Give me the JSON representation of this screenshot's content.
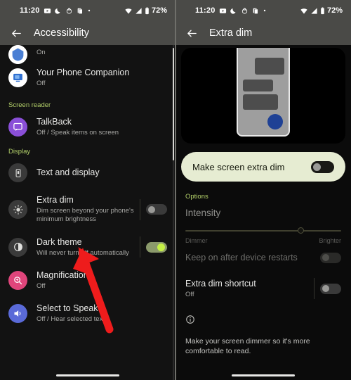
{
  "statusbar": {
    "time": "11:20",
    "battery_percent": "72%",
    "icons": [
      "youtube-icon",
      "moon-icon",
      "do-not-disturb-icon",
      "copy-icon",
      "dot-icon",
      "wifi-icon",
      "signal-icon",
      "battery-icon"
    ]
  },
  "left_panel": {
    "title": "Accessibility",
    "back_icon": "back-arrow-icon",
    "partial_item": {
      "subtitle": "On",
      "icon": "app-icon"
    },
    "items_top": [
      {
        "title": "Your Phone Companion",
        "subtitle": "Off",
        "icon": "phone-companion-icon"
      }
    ],
    "sections": [
      {
        "label": "Screen reader",
        "items": [
          {
            "title": "TalkBack",
            "subtitle": "Off / Speak items on screen",
            "icon": "talkback-icon"
          }
        ]
      },
      {
        "label": "Display",
        "items": [
          {
            "title": "Text and display",
            "subtitle": "",
            "icon": "text-display-icon",
            "toggle": null
          },
          {
            "title": "Extra dim",
            "subtitle": "Dim screen beyond your phone's minimum brightness",
            "icon": "extra-dim-icon",
            "toggle": "off"
          },
          {
            "title": "Dark theme",
            "subtitle": "Will never turn off automatically",
            "icon": "dark-theme-icon",
            "toggle": "on"
          },
          {
            "title": "Magnification",
            "subtitle": "Off",
            "icon": "magnification-icon",
            "toggle": null
          },
          {
            "title": "Select to Speak",
            "subtitle": "Off / Hear selected text",
            "icon": "select-to-speak-icon",
            "toggle": null
          }
        ]
      }
    ]
  },
  "right_panel": {
    "title": "Extra dim",
    "back_icon": "back-arrow-icon",
    "preview_icon": "phone-preview-illustration",
    "main_toggle": {
      "label": "Make screen extra dim",
      "state": "off"
    },
    "options_label": "Options",
    "intensity": {
      "label": "Intensity",
      "value_percent": 73,
      "min_label": "Dimmer",
      "max_label": "Brighter"
    },
    "rows": [
      {
        "title": "Keep on after device restarts",
        "subtitle": "",
        "toggle": "dim",
        "disabled": true
      },
      {
        "title": "Extra dim shortcut",
        "subtitle": "Off",
        "toggle": "off",
        "disabled": false
      }
    ],
    "info": {
      "icon": "info-icon",
      "text": "Make your screen dimmer so it's more comfortable to read."
    }
  },
  "annotation": {
    "type": "red-arrow",
    "color": "#ee1c1c"
  },
  "colors": {
    "accent_green": "#b4d16a",
    "card_bg": "#e6ecd2",
    "toggle_on": "#c4f045",
    "status_bar": "#4a4a47"
  }
}
